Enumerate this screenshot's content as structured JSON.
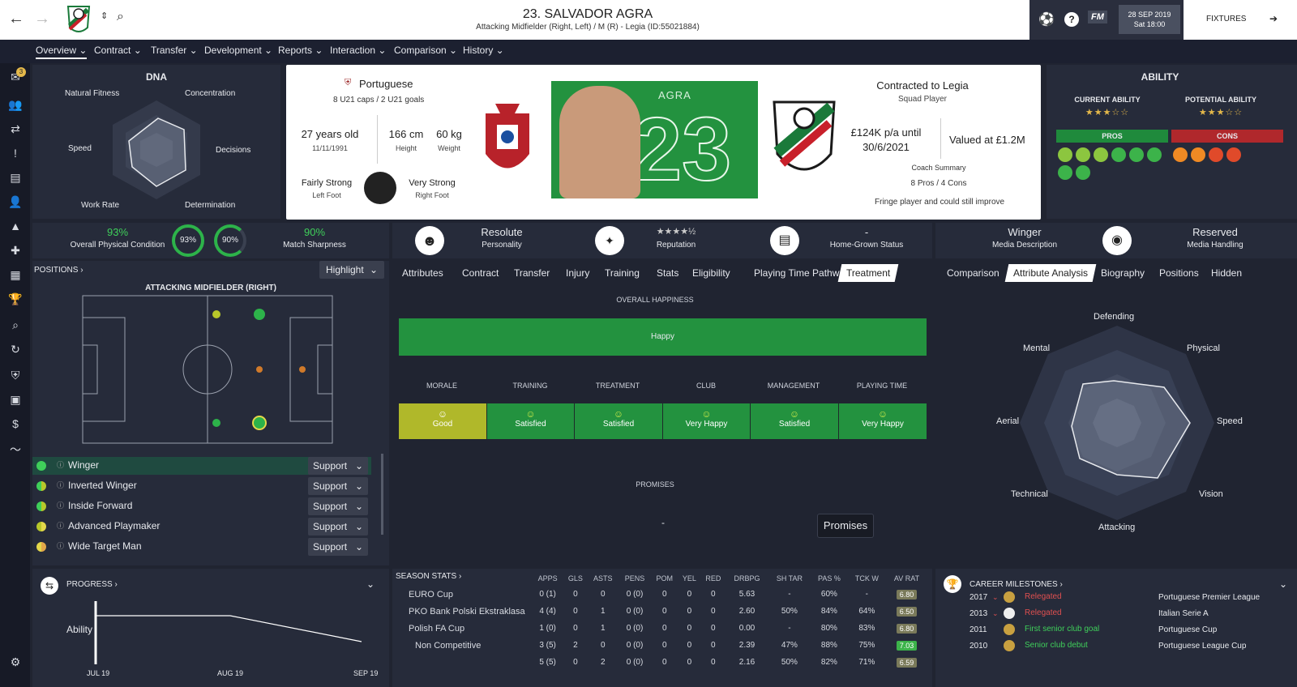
{
  "header": {
    "title": "23. SALVADOR AGRA",
    "subtitle": "Attacking Midfielder (Right, Left) / M (R) - Legia (ID:55021884)",
    "date": "28 SEP 2019",
    "time": "Sat 18:00",
    "fixtures_label": "FIXTURES",
    "fm_label": "FM",
    "help_label": "?"
  },
  "nav": [
    "Overview",
    "Contract",
    "Transfer",
    "Development",
    "Reports",
    "Interaction",
    "Comparison",
    "History"
  ],
  "sidebar": {
    "badge": "3"
  },
  "dna": {
    "title": "DNA",
    "labels": [
      "Natural Fitness",
      "Concentration",
      "Speed",
      "Decisions",
      "Work Rate",
      "Determination"
    ]
  },
  "profile": {
    "nationality": "Portuguese",
    "caps": "8 U21 caps / 2 U21 goals",
    "age": "27 years old",
    "dob": "11/11/1991",
    "height": "166 cm",
    "height_label": "Height",
    "weight": "60 kg",
    "weight_label": "Weight",
    "left_foot": "Fairly Strong",
    "left_foot_label": "Left Foot",
    "right_foot": "Very Strong",
    "right_foot_label": "Right Foot",
    "shirt_name": "AGRA",
    "shirt_number": "23",
    "contract_title": "Contracted to Legia",
    "squad_status": "Squad Player",
    "wage": "£124K p/a until",
    "until": "30/6/2021",
    "value": "Valued at £1.2M",
    "coach_summary_label": "Coach Summary",
    "coach_summary": "8 Pros / 4 Cons",
    "coach_note": "Fringe player and could still improve"
  },
  "ability": {
    "title": "ABILITY",
    "current_label": "CURRENT ABILITY",
    "current_stars": "★★★☆☆",
    "potential_label": "POTENTIAL ABILITY",
    "potential_stars": "★★★☆☆",
    "pros_label": "PROS",
    "cons_label": "CONS",
    "current_value": 2.5,
    "potential_value": 3,
    "colors": {
      "pros": "#1f8a3c",
      "cons": "#b0282c"
    }
  },
  "condition": {
    "physical": "93%",
    "physical_label": "Overall Physical Condition",
    "ring1": "93%",
    "ring2": "90%",
    "sharpness": "90%",
    "sharpness_label": "Match Sharpness"
  },
  "traits": {
    "personality": "Resolute",
    "personality_label": "Personality",
    "reputation_label": "Reputation",
    "reputation_stars": "★★★★½",
    "homegrown": "-",
    "homegrown_label": "Home-Grown Status",
    "media_desc": "Winger",
    "media_desc_label": "Media Description",
    "media_handling": "Reserved",
    "media_handling_label": "Media Handling"
  },
  "positions": {
    "label": "POSITIONS",
    "highlight": "Highlight",
    "pitch_title": "ATTACKING MIDFIELDER (RIGHT)",
    "roles": [
      {
        "name": "Winger",
        "duty": "Support"
      },
      {
        "name": "Inverted Winger",
        "duty": "Support"
      },
      {
        "name": "Inside Forward",
        "duty": "Support"
      },
      {
        "name": "Advanced Playmaker",
        "duty": "Support"
      },
      {
        "name": "Wide Target Man",
        "duty": "Support"
      }
    ]
  },
  "center_tabs": [
    "Attributes",
    "Contract",
    "Transfer",
    "Injury",
    "Training",
    "Stats",
    "Eligibility",
    "Playing Time Pathway",
    "Treatment"
  ],
  "happiness": {
    "overall_label": "OVERALL HAPPINESS",
    "overall": "Happy",
    "cols": [
      {
        "head": "MORALE",
        "value": "Good"
      },
      {
        "head": "TRAINING",
        "value": "Satisfied"
      },
      {
        "head": "TREATMENT",
        "value": "Satisfied"
      },
      {
        "head": "CLUB",
        "value": "Very Happy"
      },
      {
        "head": "MANAGEMENT",
        "value": "Satisfied"
      },
      {
        "head": "PLAYING TIME",
        "value": "Very Happy"
      }
    ],
    "promises_label": "PROMISES",
    "promises_value": "-",
    "promises_button": "Promises"
  },
  "right_tabs": [
    "Comparison",
    "Attribute Analysis",
    "Biography",
    "Positions",
    "Hidden"
  ],
  "attr_analysis": {
    "labels": [
      "Defending",
      "Physical",
      "Speed",
      "Vision",
      "Attacking",
      "Technical",
      "Aerial",
      "Mental"
    ]
  },
  "progress": {
    "label": "PROGRESS",
    "y_label": "Ability",
    "x_labels": [
      "JUL 19",
      "AUG 19",
      "SEP 19"
    ]
  },
  "season_stats": {
    "label": "SEASON STATS",
    "headers": [
      "APPS",
      "GLS",
      "ASTS",
      "PENS",
      "POM",
      "YEL",
      "RED",
      "DRBPG",
      "SH TAR",
      "PAS %",
      "TCK W",
      "AV RAT"
    ],
    "rows": [
      {
        "name": "EURO Cup",
        "vals": [
          "0 (1)",
          "0",
          "0",
          "0 (0)",
          "0",
          "0",
          "0",
          "5.63",
          "-",
          "60%",
          "-",
          "6.80"
        ]
      },
      {
        "name": "PKO Bank Polski Ekstraklasa",
        "vals": [
          "4 (4)",
          "0",
          "1",
          "0 (0)",
          "0",
          "0",
          "0",
          "2.60",
          "50%",
          "84%",
          "64%",
          "6.50"
        ]
      },
      {
        "name": "Polish FA Cup",
        "vals": [
          "1 (0)",
          "0",
          "1",
          "0 (0)",
          "0",
          "0",
          "0",
          "0.00",
          "-",
          "80%",
          "83%",
          "6.80"
        ]
      },
      {
        "name": "Non Competitive",
        "vals": [
          "3 (5)",
          "2",
          "0",
          "0 (0)",
          "0",
          "0",
          "0",
          "2.39",
          "47%",
          "88%",
          "75%",
          "7.03"
        ]
      },
      {
        "name": "",
        "vals": [
          "5 (5)",
          "0",
          "2",
          "0 (0)",
          "0",
          "0",
          "0",
          "2.16",
          "50%",
          "82%",
          "71%",
          "6.59"
        ]
      }
    ]
  },
  "milestones": {
    "label": "CAREER MILESTONES",
    "items": [
      {
        "year": "2017",
        "text": "Relegated",
        "comp": "Portuguese Premier League",
        "color": "#e05050"
      },
      {
        "year": "2013",
        "text": "Relegated",
        "comp": "Italian Serie A",
        "color": "#e05050"
      },
      {
        "year": "2011",
        "text": "First senior club goal",
        "comp": "Portuguese Cup",
        "color": "#3fcf5a"
      },
      {
        "year": "2010",
        "text": "Senior club debut",
        "comp": "Portuguese League Cup",
        "color": "#3fcf5a"
      }
    ]
  }
}
